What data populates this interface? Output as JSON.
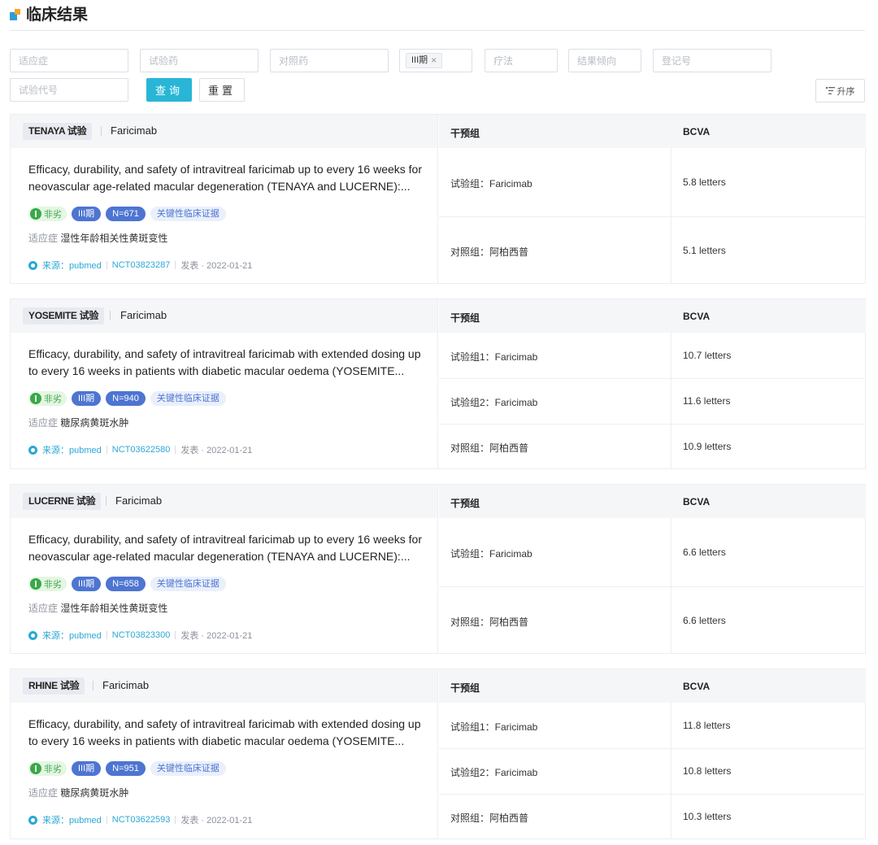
{
  "header": {
    "title": "临床结果"
  },
  "filters": {
    "indication_placeholder": "适应症",
    "test_drug_placeholder": "试验药",
    "control_drug_placeholder": "对照药",
    "phase_chip": "III期",
    "therapy_placeholder": "疗法",
    "result_trend_placeholder": "结果倾向",
    "registration_placeholder": "登记号",
    "trial_code_placeholder": "试验代号",
    "query_label": "查询",
    "reset_label": "重置",
    "sort_label": "升序"
  },
  "table": {
    "col_group": "干预组",
    "col_metric": "BCVA"
  },
  "labels": {
    "indication_label": "适应症",
    "source_prefix": "来源：",
    "publish_label": "发表"
  },
  "cards": [
    {
      "trial": "TENAYA 试验",
      "drug": "Faricimab",
      "title": "Efficacy, durability, and safety of intravitreal faricimab up to every 16 weeks for neovascular age-related macular degeneration (TENAYA and LUCERNE):...",
      "tag_result": "非劣",
      "tag_phase": "III期",
      "tag_n": "N=671",
      "tag_evidence": "关键性临床证据",
      "indication": "湿性年龄相关性黄斑变性",
      "source": "pubmed",
      "nct": "NCT03823287",
      "date": "2022-01-21",
      "rows": [
        {
          "group": "试验组：Faricimab",
          "value": "5.8 letters"
        },
        {
          "group": "对照组：阿柏西普",
          "value": "5.1 letters"
        }
      ]
    },
    {
      "trial": "YOSEMITE 试验",
      "drug": "Faricimab",
      "title": "Efficacy, durability, and safety of intravitreal faricimab with extended dosing up to every 16 weeks in patients with diabetic macular oedema (YOSEMITE...",
      "tag_result": "非劣",
      "tag_phase": "III期",
      "tag_n": "N=940",
      "tag_evidence": "关键性临床证据",
      "indication": "糖尿病黄斑水肿",
      "source": "pubmed",
      "nct": "NCT03622580",
      "date": "2022-01-21",
      "rows": [
        {
          "group": "试验组1：Faricimab",
          "value": "10.7 letters"
        },
        {
          "group": "试验组2：Faricimab",
          "value": "11.6 letters"
        },
        {
          "group": "对照组：阿柏西普",
          "value": "10.9 letters"
        }
      ]
    },
    {
      "trial": "LUCERNE 试验",
      "drug": "Faricimab",
      "title": "Efficacy, durability, and safety of intravitreal faricimab up to every 16 weeks for neovascular age-related macular degeneration (TENAYA and LUCERNE):...",
      "tag_result": "非劣",
      "tag_phase": "III期",
      "tag_n": "N=658",
      "tag_evidence": "关键性临床证据",
      "indication": "湿性年龄相关性黄斑变性",
      "source": "pubmed",
      "nct": "NCT03823300",
      "date": "2022-01-21",
      "rows": [
        {
          "group": "试验组：Faricimab",
          "value": "6.6 letters"
        },
        {
          "group": "对照组：阿柏西普",
          "value": "6.6 letters"
        }
      ]
    },
    {
      "trial": "RHINE 试验",
      "drug": "Faricimab",
      "title": "Efficacy, durability, and safety of intravitreal faricimab with extended dosing up to every 16 weeks in patients with diabetic macular oedema (YOSEMITE...",
      "tag_result": "非劣",
      "tag_phase": "III期",
      "tag_n": "N=951",
      "tag_evidence": "关键性临床证据",
      "indication": "糖尿病黄斑水肿",
      "source": "pubmed",
      "nct": "NCT03622593",
      "date": "2022-01-21",
      "rows": [
        {
          "group": "试验组1：Faricimab",
          "value": "11.8 letters"
        },
        {
          "group": "试验组2：Faricimab",
          "value": "10.8 letters"
        },
        {
          "group": "对照组：阿柏西普",
          "value": "10.3 letters"
        }
      ]
    }
  ]
}
